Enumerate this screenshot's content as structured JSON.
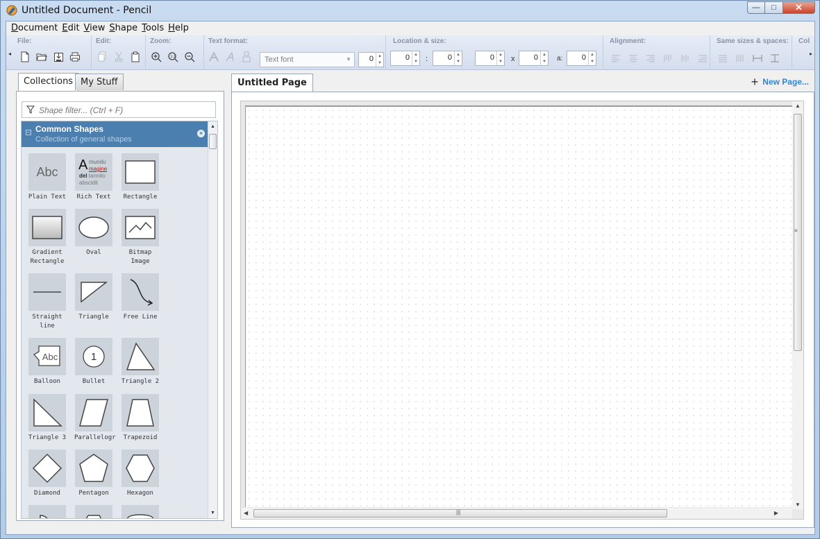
{
  "window": {
    "title": "Untitled Document - Pencil",
    "controls": {
      "minimize": "—",
      "maximize": "□",
      "close": "✕"
    }
  },
  "menu": {
    "items": [
      {
        "label": "Document",
        "key": "D"
      },
      {
        "label": "Edit",
        "key": "E"
      },
      {
        "label": "View",
        "key": "V"
      },
      {
        "label": "Shape",
        "key": "S"
      },
      {
        "label": "Tools",
        "key": "T"
      },
      {
        "label": "Help",
        "key": "H"
      }
    ]
  },
  "toolbar": {
    "file_label": "File:",
    "edit_label": "Edit:",
    "zoom_label": "Zoom:",
    "text_format_label": "Text format:",
    "location_label": "Location & size:",
    "alignment_label": "Alignment:",
    "same_sizes_label": "Same sizes & spaces:",
    "col_label": "Col",
    "font_combo": "Text font",
    "font_size": "0",
    "x": "0",
    "y": "0",
    "width": "0",
    "height": "0",
    "angle": "0",
    "colon": ":",
    "times": "x",
    "angle_label": "a:"
  },
  "left": {
    "tabs": [
      "Collections",
      "My Stuff"
    ],
    "filter_placeholder": "Shape filter... (Ctrl + F)",
    "collection": {
      "name": "Common Shapes",
      "description": "Collection of general shapes"
    },
    "shapes": [
      {
        "label": "Plain Text",
        "icon": "plain-text"
      },
      {
        "label": "Rich Text",
        "icon": "rich-text"
      },
      {
        "label": "Rectangle",
        "icon": "rectangle"
      },
      {
        "label": "Gradient Rectangle",
        "icon": "gradient-rectangle"
      },
      {
        "label": "Oval",
        "icon": "oval"
      },
      {
        "label": "Bitmap Image",
        "icon": "bitmap-image"
      },
      {
        "label": "Straight line",
        "icon": "straight-line"
      },
      {
        "label": "Triangle",
        "icon": "triangle"
      },
      {
        "label": "Free Line",
        "icon": "free-line"
      },
      {
        "label": "Balloon",
        "icon": "balloon"
      },
      {
        "label": "Bullet",
        "icon": "bullet"
      },
      {
        "label": "Triangle 2",
        "icon": "triangle-2"
      },
      {
        "label": "Triangle 3",
        "icon": "triangle-3"
      },
      {
        "label": "Parallelogr",
        "icon": "parallelogram"
      },
      {
        "label": "Trapezoid",
        "icon": "trapezoid"
      },
      {
        "label": "Diamond",
        "icon": "diamond"
      },
      {
        "label": "Pentagon",
        "icon": "pentagon"
      },
      {
        "label": "Hexagon",
        "icon": "hexagon"
      }
    ],
    "plain_text_sample": "Abc",
    "rich_text_sample": {
      "big": "A",
      "l1": "mundu",
      "l2": "magine",
      "l3a": "del",
      "l3b": " tannito",
      "l4": "abscidit"
    },
    "balloon_sample": "Abc",
    "bullet_sample": "1"
  },
  "page": {
    "tab_label": "Untitled Page",
    "new_page_label": "New Page...",
    "new_page_icon": "+"
  },
  "colors": {
    "accent": "#4a7faf",
    "link": "#2f86d8"
  }
}
